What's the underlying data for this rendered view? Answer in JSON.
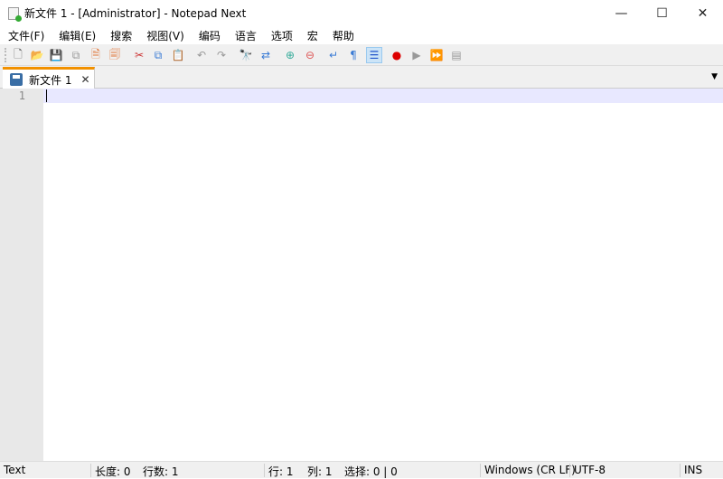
{
  "window": {
    "title": "新文件 1 - [Administrator] - Notepad Next",
    "minimize": "—",
    "maximize": "☐",
    "close": "✕"
  },
  "menu": [
    "文件(F)",
    "编辑(E)",
    "搜索",
    "视图(V)",
    "编码",
    "语言",
    "选项",
    "宏",
    "帮助"
  ],
  "toolbar": [
    {
      "name": "new-file",
      "glyph": "🗋",
      "color": "#555"
    },
    {
      "name": "open-file",
      "glyph": "📂",
      "color": "#e8b040"
    },
    {
      "name": "save",
      "glyph": "💾",
      "color": "#888"
    },
    {
      "name": "save-all",
      "glyph": "⧉",
      "color": "#999"
    },
    {
      "name": "close-file",
      "glyph": "🗎",
      "color": "#e07030"
    },
    {
      "name": "close-all",
      "glyph": "🗐",
      "color": "#e07030"
    },
    {
      "name": "cut",
      "glyph": "✂",
      "color": "#c33"
    },
    {
      "name": "copy",
      "glyph": "⧉",
      "color": "#3a7bd5"
    },
    {
      "name": "paste",
      "glyph": "📋",
      "color": "#c9a050"
    },
    {
      "name": "undo",
      "glyph": "↶",
      "color": "#999"
    },
    {
      "name": "redo",
      "glyph": "↷",
      "color": "#999"
    },
    {
      "name": "find",
      "glyph": "🔭",
      "color": "#333"
    },
    {
      "name": "replace",
      "glyph": "⇄",
      "color": "#3a7bd5"
    },
    {
      "name": "zoom-in",
      "glyph": "⊕",
      "color": "#3a9"
    },
    {
      "name": "zoom-out",
      "glyph": "⊖",
      "color": "#d55"
    },
    {
      "name": "word-wrap",
      "glyph": "↵",
      "color": "#3a7bd5"
    },
    {
      "name": "show-all-chars",
      "glyph": "¶",
      "color": "#3a7bd5"
    },
    {
      "name": "indent-guide",
      "glyph": "☰",
      "color": "#2255cc",
      "active": true
    },
    {
      "name": "macro-record",
      "glyph": "●",
      "color": "#d00"
    },
    {
      "name": "macro-play",
      "glyph": "▶",
      "color": "#999"
    },
    {
      "name": "macro-run-multiple",
      "glyph": "⏩",
      "color": "#999"
    },
    {
      "name": "macro-save",
      "glyph": "▤",
      "color": "#999"
    }
  ],
  "tab": {
    "label": "新文件 1",
    "close": "✕",
    "dropdown": "▼"
  },
  "editor": {
    "line_numbers": [
      "1"
    ]
  },
  "status": {
    "language": "Text",
    "length": "长度: 0",
    "lines": "行数: 1",
    "line": "行: 1",
    "col": "列: 1",
    "selection": "选择: 0 | 0",
    "eol": "Windows (CR LF)",
    "encoding": "UTF-8",
    "mode": "INS"
  }
}
